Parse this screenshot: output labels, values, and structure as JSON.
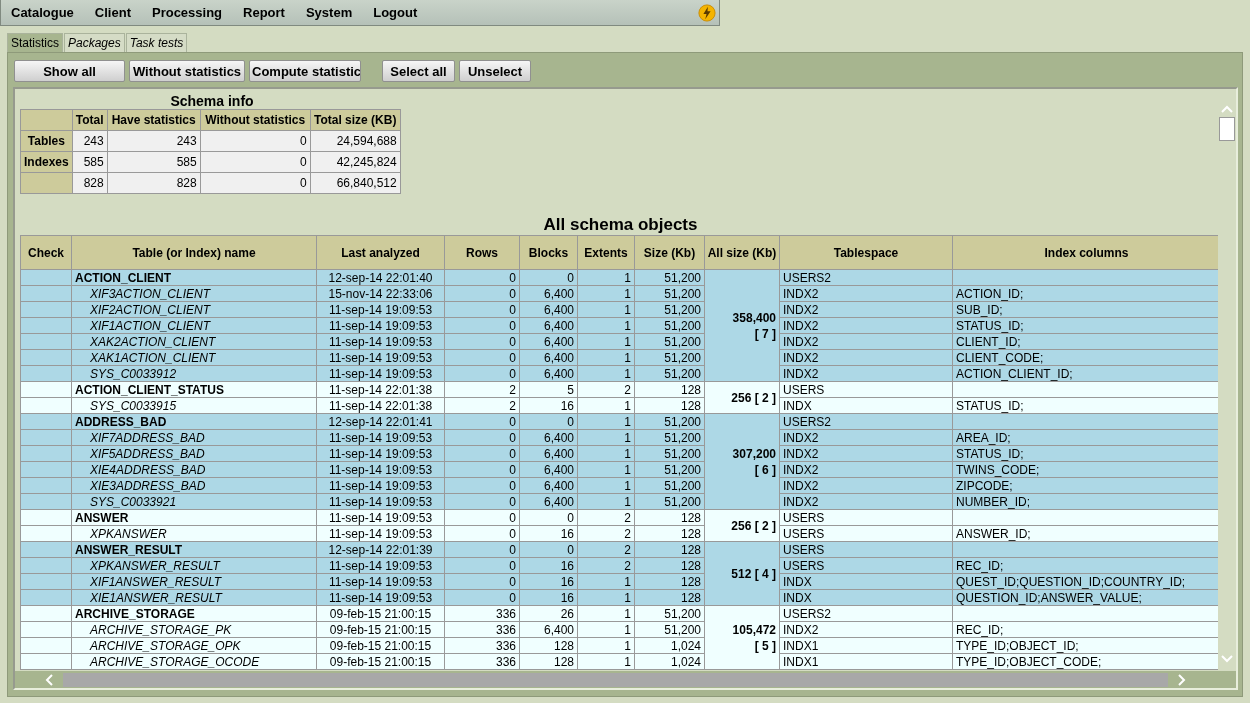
{
  "menu": [
    {
      "label": "Catalogue"
    },
    {
      "label": "Client"
    },
    {
      "label": "Processing"
    },
    {
      "label": "Report"
    },
    {
      "label": "System"
    },
    {
      "label": "Logout"
    }
  ],
  "tabs": [
    {
      "label": "Statistics",
      "selected": true
    },
    {
      "label": "Packages",
      "selected": false
    },
    {
      "label": "Task tests",
      "selected": false
    }
  ],
  "button_groups": [
    [
      {
        "label": "Show all"
      },
      {
        "label": "Without statistics"
      },
      {
        "label": "Compute statistic"
      }
    ],
    [
      {
        "label": "Select all"
      },
      {
        "label": "Unselect"
      }
    ]
  ],
  "schema_info": {
    "title": "Schema info",
    "columns": [
      "Total",
      "Have statistics",
      "Without statistics",
      "Total size (KB)"
    ],
    "rows": [
      {
        "label": "Tables",
        "values": [
          "243",
          "243",
          "0",
          "24,594,688"
        ]
      },
      {
        "label": "Indexes",
        "values": [
          "585",
          "585",
          "0",
          "42,245,824"
        ]
      },
      {
        "values": [
          "828",
          "828",
          "0",
          "66,840,512"
        ]
      }
    ]
  },
  "objects": {
    "title": "All schema objects",
    "columns": [
      "Check",
      "Table (or Index) name",
      "Last analyzed",
      "Rows",
      "Blocks",
      "Extents",
      "Size (Kb)",
      "All size (Kb)",
      "Tablespace",
      "Index columns"
    ],
    "groups": [
      {
        "all_size": "358,400",
        "count": "[ 7 ]",
        "rows": [
          {
            "kind": "table",
            "name": "ACTION_CLIENT",
            "analyzed": "12-sep-14 22:01:40",
            "rows": "0",
            "blocks": "0",
            "extents": "1",
            "size": "51,200",
            "tablespace": "USERS2"
          },
          {
            "kind": "index",
            "name": "XIF3ACTION_CLIENT",
            "analyzed": "15-nov-14 22:33:06",
            "rows": "0",
            "blocks": "6,400",
            "extents": "1",
            "size": "51,200",
            "tablespace": "INDX2",
            "columns": "ACTION_ID;"
          },
          {
            "kind": "index",
            "name": "XIF2ACTION_CLIENT",
            "analyzed": "11-sep-14 19:09:53",
            "rows": "0",
            "blocks": "6,400",
            "extents": "1",
            "size": "51,200",
            "tablespace": "INDX2",
            "columns": "SUB_ID;"
          },
          {
            "kind": "index",
            "name": "XIF1ACTION_CLIENT",
            "analyzed": "11-sep-14 19:09:53",
            "rows": "0",
            "blocks": "6,400",
            "extents": "1",
            "size": "51,200",
            "tablespace": "INDX2",
            "columns": "STATUS_ID;"
          },
          {
            "kind": "index",
            "name": "XAK2ACTION_CLIENT",
            "analyzed": "11-sep-14 19:09:53",
            "rows": "0",
            "blocks": "6,400",
            "extents": "1",
            "size": "51,200",
            "tablespace": "INDX2",
            "columns": "CLIENT_ID;"
          },
          {
            "kind": "index",
            "name": "XAK1ACTION_CLIENT",
            "analyzed": "11-sep-14 19:09:53",
            "rows": "0",
            "blocks": "6,400",
            "extents": "1",
            "size": "51,200",
            "tablespace": "INDX2",
            "columns": "CLIENT_CODE;"
          },
          {
            "kind": "index",
            "name": "SYS_C0033912",
            "analyzed": "11-sep-14 19:09:53",
            "rows": "0",
            "blocks": "6,400",
            "extents": "1",
            "size": "51,200",
            "tablespace": "INDX2",
            "columns": "ACTION_CLIENT_ID;"
          }
        ]
      },
      {
        "all_size": "256",
        "count": "[ 2 ]",
        "rows": [
          {
            "kind": "table",
            "name": "ACTION_CLIENT_STATUS",
            "analyzed": "11-sep-14 22:01:38",
            "rows": "2",
            "blocks": "5",
            "extents": "2",
            "size": "128",
            "tablespace": "USERS"
          },
          {
            "kind": "index",
            "name": "SYS_C0033915",
            "analyzed": "11-sep-14 22:01:38",
            "rows": "2",
            "blocks": "16",
            "extents": "1",
            "size": "128",
            "tablespace": "INDX",
            "columns": "STATUS_ID;"
          }
        ]
      },
      {
        "all_size": "307,200",
        "count": "[ 6 ]",
        "rows": [
          {
            "kind": "table",
            "name": "ADDRESS_BAD",
            "analyzed": "12-sep-14 22:01:41",
            "rows": "0",
            "blocks": "0",
            "extents": "1",
            "size": "51,200",
            "tablespace": "USERS2"
          },
          {
            "kind": "index",
            "name": "XIF7ADDRESS_BAD",
            "analyzed": "11-sep-14 19:09:53",
            "rows": "0",
            "blocks": "6,400",
            "extents": "1",
            "size": "51,200",
            "tablespace": "INDX2",
            "columns": "AREA_ID;"
          },
          {
            "kind": "index",
            "name": "XIF5ADDRESS_BAD",
            "analyzed": "11-sep-14 19:09:53",
            "rows": "0",
            "blocks": "6,400",
            "extents": "1",
            "size": "51,200",
            "tablespace": "INDX2",
            "columns": "STATUS_ID;"
          },
          {
            "kind": "index",
            "name": "XIE4ADDRESS_BAD",
            "analyzed": "11-sep-14 19:09:53",
            "rows": "0",
            "blocks": "6,400",
            "extents": "1",
            "size": "51,200",
            "tablespace": "INDX2",
            "columns": "TWINS_CODE;"
          },
          {
            "kind": "index",
            "name": "XIE3ADDRESS_BAD",
            "analyzed": "11-sep-14 19:09:53",
            "rows": "0",
            "blocks": "6,400",
            "extents": "1",
            "size": "51,200",
            "tablespace": "INDX2",
            "columns": "ZIPCODE;"
          },
          {
            "kind": "index",
            "name": "SYS_C0033921",
            "analyzed": "11-sep-14 19:09:53",
            "rows": "0",
            "blocks": "6,400",
            "extents": "1",
            "size": "51,200",
            "tablespace": "INDX2",
            "columns": "NUMBER_ID;"
          }
        ]
      },
      {
        "all_size": "256",
        "count": "[ 2 ]",
        "rows": [
          {
            "kind": "table",
            "name": "ANSWER",
            "analyzed": "11-sep-14 19:09:53",
            "rows": "0",
            "blocks": "0",
            "extents": "2",
            "size": "128",
            "tablespace": "USERS"
          },
          {
            "kind": "index",
            "name": "XPKANSWER",
            "analyzed": "11-sep-14 19:09:53",
            "rows": "0",
            "blocks": "16",
            "extents": "2",
            "size": "128",
            "tablespace": "USERS",
            "columns": "ANSWER_ID;"
          }
        ]
      },
      {
        "all_size": "512",
        "count": "[ 4 ]",
        "rows": [
          {
            "kind": "table",
            "name": "ANSWER_RESULT",
            "analyzed": "12-sep-14 22:01:39",
            "rows": "0",
            "blocks": "0",
            "extents": "2",
            "size": "128",
            "tablespace": "USERS"
          },
          {
            "kind": "index",
            "name": "XPKANSWER_RESULT",
            "analyzed": "11-sep-14 19:09:53",
            "rows": "0",
            "blocks": "16",
            "extents": "2",
            "size": "128",
            "tablespace": "USERS",
            "columns": "REC_ID;"
          },
          {
            "kind": "index",
            "name": "XIF1ANSWER_RESULT",
            "analyzed": "11-sep-14 19:09:53",
            "rows": "0",
            "blocks": "16",
            "extents": "1",
            "size": "128",
            "tablespace": "INDX",
            "columns": "QUEST_ID;QUESTION_ID;COUNTRY_ID;"
          },
          {
            "kind": "index",
            "name": "XIE1ANSWER_RESULT",
            "analyzed": "11-sep-14 19:09:53",
            "rows": "0",
            "blocks": "16",
            "extents": "1",
            "size": "128",
            "tablespace": "INDX",
            "columns": "QUESTION_ID;ANSWER_VALUE;"
          }
        ]
      },
      {
        "all_size": "105,472",
        "count": "[ 5 ]",
        "rows": [
          {
            "kind": "table",
            "name": "ARCHIVE_STORAGE",
            "analyzed": "09-feb-15 21:00:15",
            "rows": "336",
            "blocks": "26",
            "extents": "1",
            "size": "51,200",
            "tablespace": "USERS2"
          },
          {
            "kind": "index",
            "name": "ARCHIVE_STORAGE_PK",
            "analyzed": "09-feb-15 21:00:15",
            "rows": "336",
            "blocks": "6,400",
            "extents": "1",
            "size": "51,200",
            "tablespace": "INDX2",
            "columns": "REC_ID;"
          },
          {
            "kind": "index",
            "name": "ARCHIVE_STORAGE_OPK",
            "analyzed": "09-feb-15 21:00:15",
            "rows": "336",
            "blocks": "128",
            "extents": "1",
            "size": "1,024",
            "tablespace": "INDX1",
            "columns": "TYPE_ID;OBJECT_ID;"
          },
          {
            "kind": "index",
            "name": "ARCHIVE_STORAGE_OCODE",
            "analyzed": "09-feb-15 21:00:15",
            "rows": "336",
            "blocks": "128",
            "extents": "1",
            "size": "1,024",
            "tablespace": "INDX1",
            "columns": "TYPE_ID;OBJECT_CODE;"
          }
        ]
      }
    ]
  }
}
